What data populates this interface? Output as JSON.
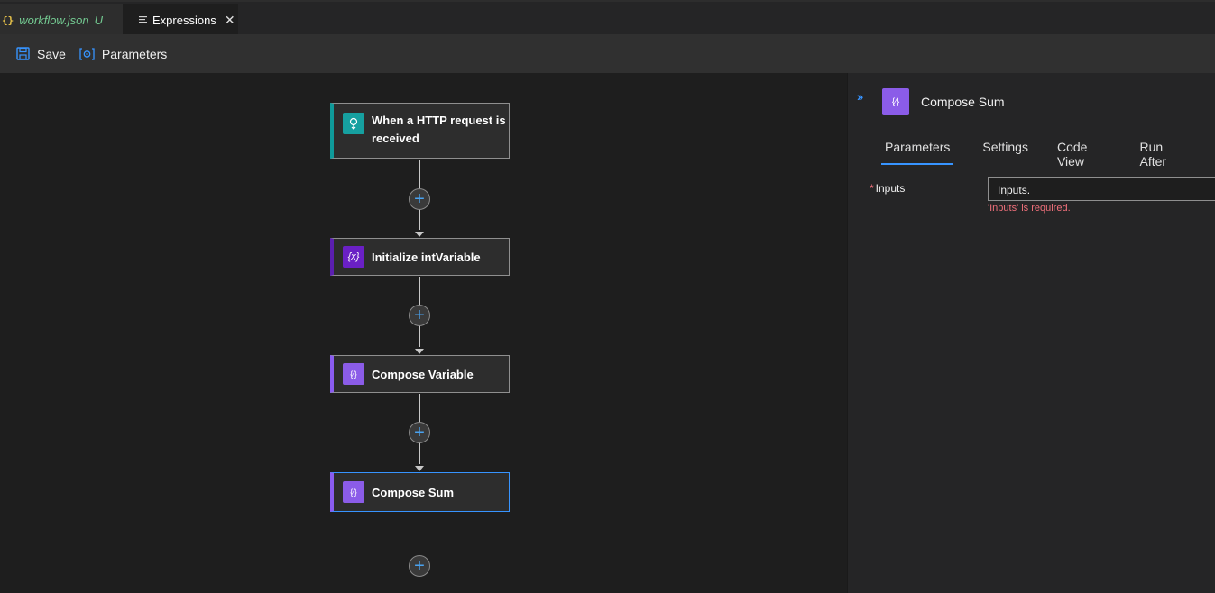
{
  "tabs": {
    "file_icon": "{}",
    "file_name": "workflow.json",
    "file_status": "U",
    "active_label": "Expressions",
    "close": "✕"
  },
  "toolbar": {
    "save_label": "Save",
    "parameters_label": "Parameters"
  },
  "canvas": {
    "nodes": [
      {
        "label": "When a HTTP request is received",
        "icon": "http-request-icon"
      },
      {
        "label": "Initialize intVariable",
        "icon": "variable-icon",
        "icon_text": "{x}"
      },
      {
        "label": "Compose Variable",
        "icon": "compose-icon",
        "icon_text": "{⁄}"
      },
      {
        "label": "Compose Sum",
        "icon": "compose-icon",
        "icon_text": "{⁄}",
        "selected": true
      }
    ],
    "add_symbol": "+"
  },
  "panel": {
    "collapse": "››",
    "icon_text": "{⁄}",
    "title": "Compose Sum",
    "tabs": [
      "Parameters",
      "Settings",
      "Code View",
      "Run After"
    ],
    "active_tab": "Parameters",
    "field": {
      "required_mark": "*",
      "label": "Inputs",
      "value": "Inputs.",
      "error": "'Inputs' is required."
    }
  },
  "colors": {
    "accent": "#3794ff",
    "http": "#16a0a0",
    "variable": "#6a20c5",
    "compose": "#8b5ce8",
    "error": "#f1707b",
    "modified": "#73c991"
  }
}
